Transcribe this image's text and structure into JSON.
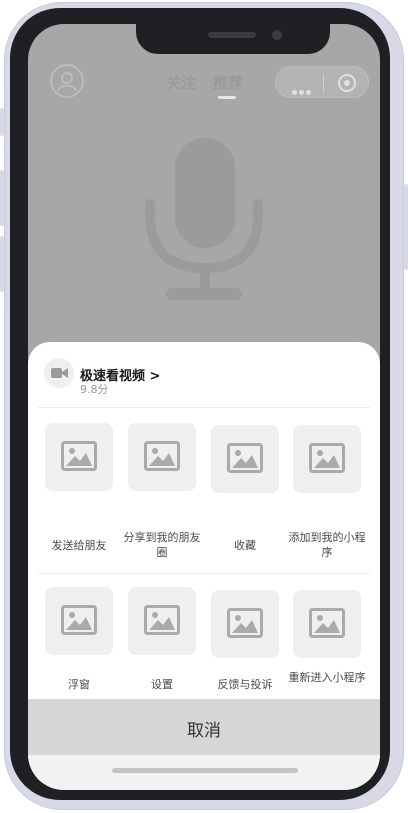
{
  "header": {
    "tabs": [
      {
        "label": "关注",
        "active": false
      },
      {
        "label": "推荐",
        "active": true
      }
    ],
    "icons": [
      "avatar-icon",
      "more-dots-icon",
      "close-target-icon"
    ]
  },
  "background_icon": "microphone-icon",
  "share_sheet": {
    "app_name": "极速看视频 >",
    "app_rating": "9.8分",
    "app_icon": "video-camera-icon",
    "row1": [
      {
        "label": "发送给朋友",
        "icon": "image-placeholder-icon"
      },
      {
        "label": "分享到我的朋友圈",
        "icon": "image-placeholder-icon"
      },
      {
        "label": "收藏",
        "icon": "image-placeholder-icon"
      },
      {
        "label": "添加到我的小程序",
        "icon": "image-placeholder-icon"
      }
    ],
    "row2": [
      {
        "label": "浮窗",
        "icon": "image-placeholder-icon"
      },
      {
        "label": "设置",
        "icon": "image-placeholder-icon"
      },
      {
        "label": "反馈与投诉",
        "icon": "image-placeholder-icon"
      },
      {
        "label": "重新进入小程序",
        "icon": "image-placeholder-icon"
      }
    ],
    "cancel_label": "取消"
  },
  "colors": {
    "overlay": "#a7a7a7",
    "sheet": "#ffffff",
    "tile": "#efefef",
    "cancel_bar": "#d6d6d6"
  }
}
